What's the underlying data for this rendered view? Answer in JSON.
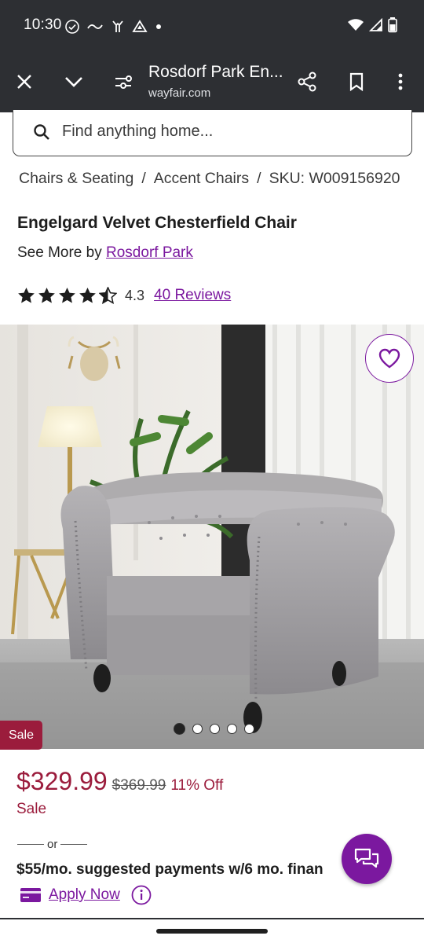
{
  "status_bar": {
    "time": "10:30",
    "icons_left": [
      "check-circle-icon",
      "tilde-icon",
      "hands-icon",
      "drive-icon",
      "dot-icon"
    ],
    "icons_right": [
      "wifi-icon",
      "signal-icon",
      "battery-icon"
    ]
  },
  "toolbar": {
    "title": "Rosdorf Park En...",
    "url": "wayfair.com",
    "icons": [
      "close-icon",
      "chevron-down-icon",
      "page-settings-icon",
      "share-icon",
      "bookmark-icon",
      "more-vert-icon"
    ]
  },
  "search": {
    "placeholder": "Find anything home..."
  },
  "breadcrumb": {
    "items": [
      "Chairs & Seating",
      "Accent Chairs",
      "SKU: W009156920"
    ],
    "separator": "/"
  },
  "product": {
    "title": "Engelgard Velvet Chesterfield Chair",
    "see_more_prefix": "See More by",
    "brand": "Rosdorf Park",
    "rating": "4.3",
    "rating_value": 4.3,
    "reviews": "40 Reviews"
  },
  "gallery": {
    "sale_tag": "Sale",
    "dot_count": 5,
    "active_dot": 0
  },
  "pricing": {
    "price": "$329.99",
    "old_price": "$369.99",
    "discount": "11% Off",
    "sale_label": "Sale",
    "or": "or",
    "payments": "$55/mo. suggested payments w/6 mo. finan",
    "apply": "Apply Now"
  },
  "colors": {
    "accent_purple": "#7b189f",
    "sale_red": "#9b1c3c",
    "chrome_dark": "#2d2f33"
  }
}
